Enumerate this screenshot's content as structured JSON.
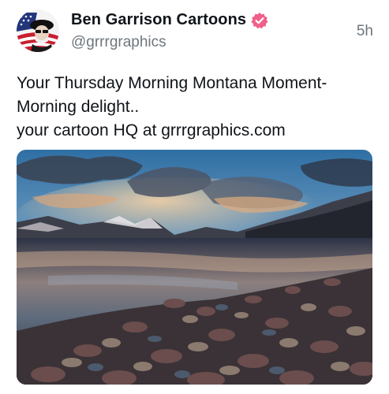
{
  "author": {
    "display_name": "Ben Garrison Cartoons",
    "handle": "@grrrgraphics",
    "verified_icon": "verified-badge-icon",
    "badge_color": "#f05f8a"
  },
  "post": {
    "timestamp": "5h",
    "text_lines": [
      "Your Thursday Morning Montana Moment-",
      "Morning delight..",
      "your cartoon HQ at grrrgraphics.com"
    ]
  },
  "media": {
    "kind": "photo",
    "subject": "mountain-lake-at-dawn"
  }
}
